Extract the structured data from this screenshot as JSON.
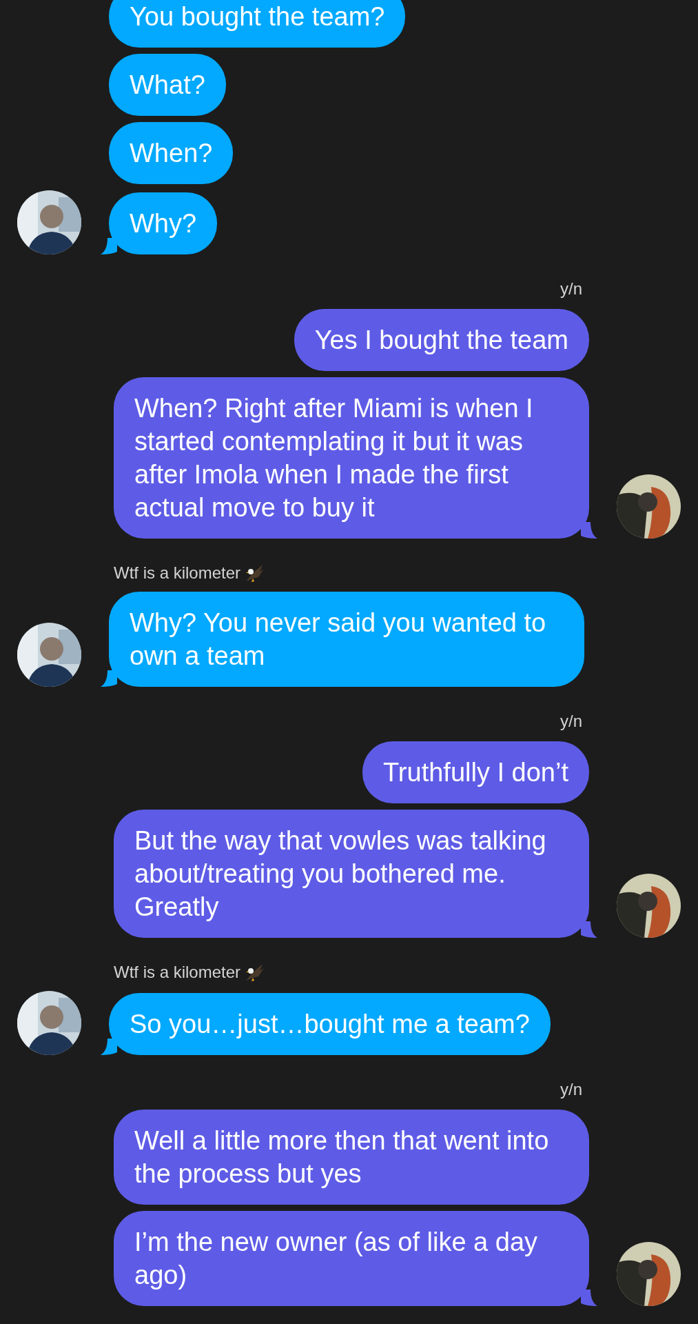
{
  "groups": [
    {
      "kind": "incoming",
      "messages": [
        "You bought the team?",
        "What?",
        "When?",
        "Why?"
      ]
    },
    {
      "kind": "outgoing",
      "sender": "y/n",
      "messages": [
        "Yes I bought the team",
        "When? Right after Miami is when I started contemplating it but it was after Imola when I made the first actual move to buy it"
      ]
    },
    {
      "kind": "incoming",
      "sender": "Wtf is a kilometer",
      "messages": [
        "Why? You never said you wanted to own a team"
      ]
    },
    {
      "kind": "outgoing",
      "sender": "y/n",
      "messages": [
        "Truthfully I don’t",
        "But the way that vowles was talking about/treating you bothered me. Greatly"
      ]
    },
    {
      "kind": "incoming",
      "sender": "Wtf is a kilometer",
      "messages": [
        "So you…just…bought me a team?"
      ]
    },
    {
      "kind": "outgoing",
      "sender": "y/n",
      "messages": [
        "Well a little more then that went into the process but yes",
        "I’m the new owner (as of like a day ago)"
      ]
    }
  ]
}
